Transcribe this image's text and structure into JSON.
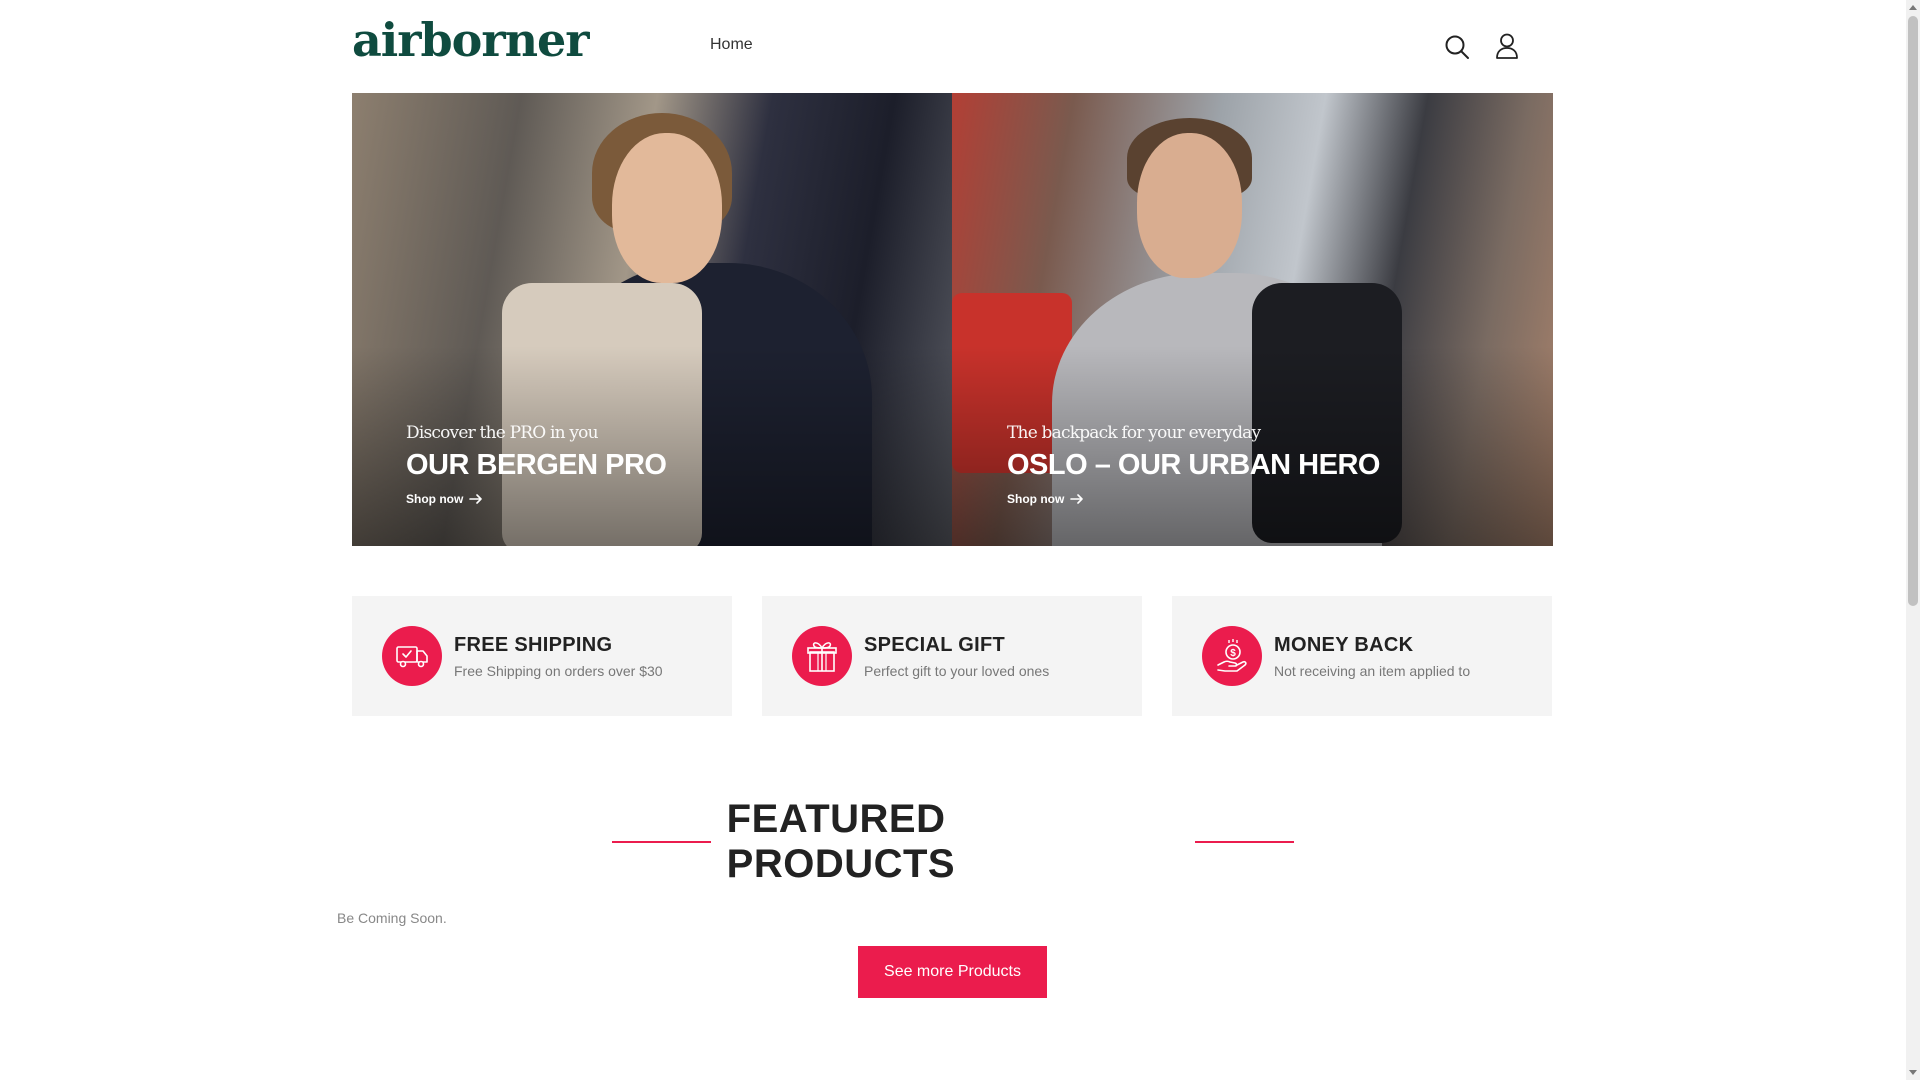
{
  "header": {
    "logo_text": "airborner",
    "nav": {
      "home_label": "Home"
    },
    "icons": {
      "search": "search-icon",
      "account": "user-icon"
    }
  },
  "hero": {
    "banners": [
      {
        "kicker": "Discover the PRO in you",
        "headline": "OUR BERGEN PRO",
        "cta": "Shop now"
      },
      {
        "kicker": "The backpack for your everyday",
        "headline": "OSLO – OUR URBAN HERO",
        "cta": "Shop now"
      }
    ]
  },
  "features": [
    {
      "title": "FREE SHIPPING",
      "description": "Free Shipping on orders over $30",
      "icon": "truck-icon"
    },
    {
      "title": "SPECIAL GIFT",
      "description": "Perfect gift to your loved ones",
      "icon": "gift-icon"
    },
    {
      "title": "MONEY BACK",
      "description": "Not receiving an item applied to",
      "icon": "money-hand-icon"
    }
  ],
  "featured": {
    "title": "FEATURED PRODUCTS",
    "empty_text": "Be Coming Soon.",
    "button_label": "See more Products"
  },
  "colors": {
    "accent": "#eb1c4d",
    "logo": "#0f4b3f",
    "feature_bg": "#f4f4f4"
  }
}
